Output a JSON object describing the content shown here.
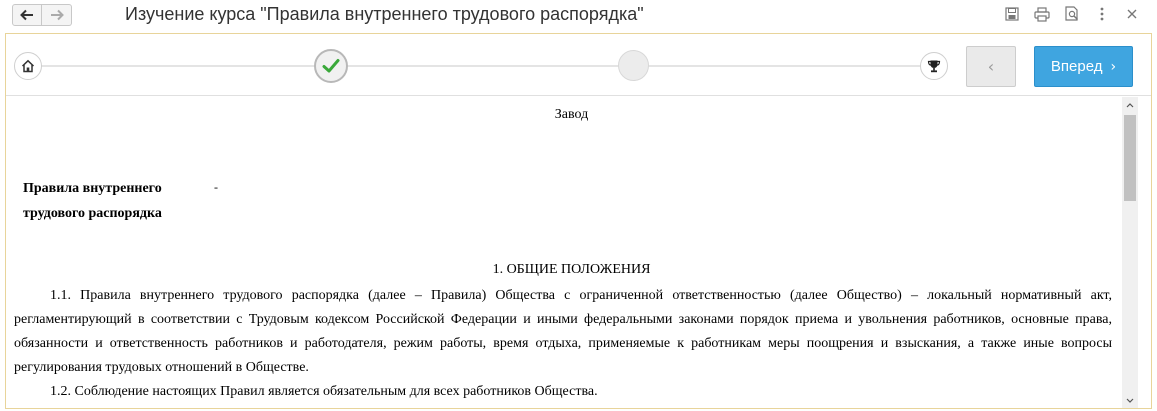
{
  "window": {
    "title": "Изучение курса \"Правила внутреннего трудового распорядка\""
  },
  "toolbar": {
    "icons": [
      "back-arrow-icon",
      "forward-arrow-icon",
      "save-icon",
      "print-icon",
      "preview-icon",
      "more-icon",
      "close-icon"
    ]
  },
  "progress": {
    "steps": [
      "home",
      "completed",
      "current",
      "finish"
    ],
    "completed_steps": 1
  },
  "navigation": {
    "prev_label": "‹",
    "next_label": "Вперед",
    "next_chevron": "›"
  },
  "colors": {
    "accent": "#3fa5e0",
    "check": "#3aa83a",
    "frame_border": "#e8d49a"
  },
  "document": {
    "company": "Завод",
    "rules_title": "Правила внутреннего трудового распорядка",
    "dash": "-",
    "section_title": "1. ОБЩИЕ ПОЛОЖЕНИЯ",
    "paragraphs": [
      "1.1. Правила внутреннего трудового распорядка (далее – Правила) Общества с ограниченной ответственностью (далее Общество) – локальный нормативный акт, регламентирующий в соответствии с Трудовым кодексом Российской Федерации и иными федеральными законами порядок приема и увольнения работников, основные права, обязанности и ответственность работников и работодателя, режим работы, время отдыха, применяемые к работникам меры поощрения и взыскания, а также иные вопросы регулирования трудовых отношений в Обществе.",
      "1.2. Соблюдение настоящих Правил является обязательным для всех работников Общества."
    ]
  }
}
